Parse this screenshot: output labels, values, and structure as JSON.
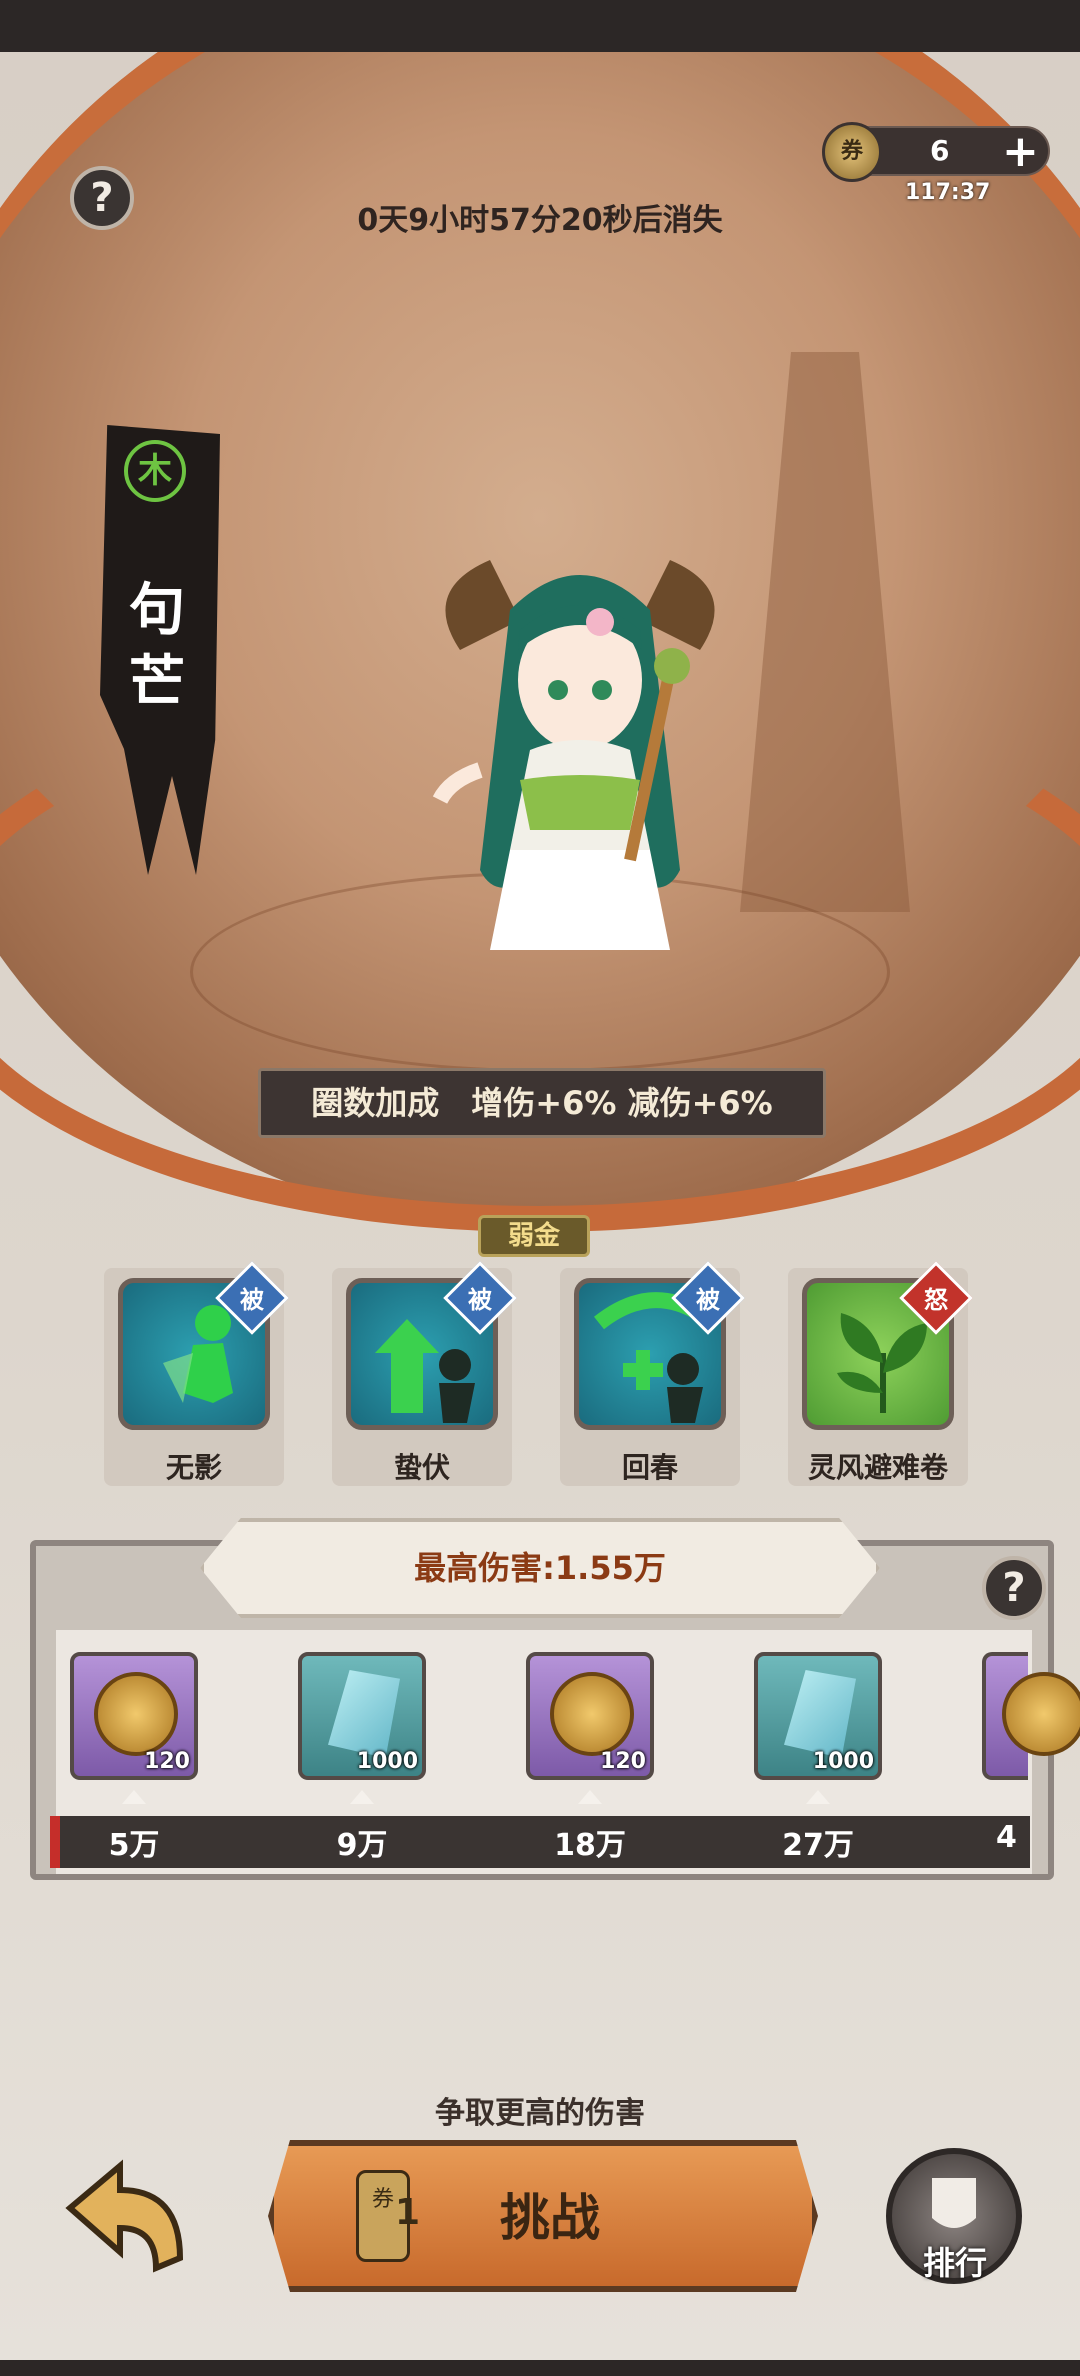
{
  "status_bar": {},
  "header": {
    "help_symbol": "?",
    "countdown": "0天9小时57分20秒后消失",
    "ticket": {
      "icon": "scroll-ticket-icon",
      "count": "6",
      "plus": "+",
      "refresh_timer": "117:37"
    }
  },
  "hero": {
    "element": "木",
    "element_color": "#6ec442",
    "name": "句芒",
    "bonus_text": "圈数加成　增伤+6% 减伤+6%",
    "weakness": "弱金"
  },
  "skills": [
    {
      "name": "无影",
      "tag": "被",
      "tag_color": "#3b6fb4",
      "icon": "running-figure-icon"
    },
    {
      "name": "蛰伏",
      "tag": "被",
      "tag_color": "#3b6fb4",
      "icon": "rising-arrows-icon"
    },
    {
      "name": "回春",
      "tag": "被",
      "tag_color": "#3b6fb4",
      "icon": "healing-cross-icon"
    },
    {
      "name": "灵风避难卷",
      "tag": "怒",
      "tag_color": "#c2332b",
      "icon": "leaf-icon"
    }
  ],
  "rewards": {
    "max_damage": "最高伤害:1.55万",
    "help_symbol": "?",
    "items": [
      {
        "type": "coin",
        "count": "120",
        "milestone": "5万"
      },
      {
        "type": "jade",
        "count": "1000",
        "milestone": "9万"
      },
      {
        "type": "coin",
        "count": "120",
        "milestone": "18万"
      },
      {
        "type": "jade",
        "count": "1000",
        "milestone": "27万"
      },
      {
        "type": "coin",
        "count": "",
        "milestone": "4"
      }
    ],
    "progress_fraction": 0.01
  },
  "footer": {
    "hint": "争取更高的伤害",
    "challenge_ticket_icon": "券",
    "challenge_count": "1",
    "challenge_label": "挑战",
    "rank_label": "排行"
  }
}
